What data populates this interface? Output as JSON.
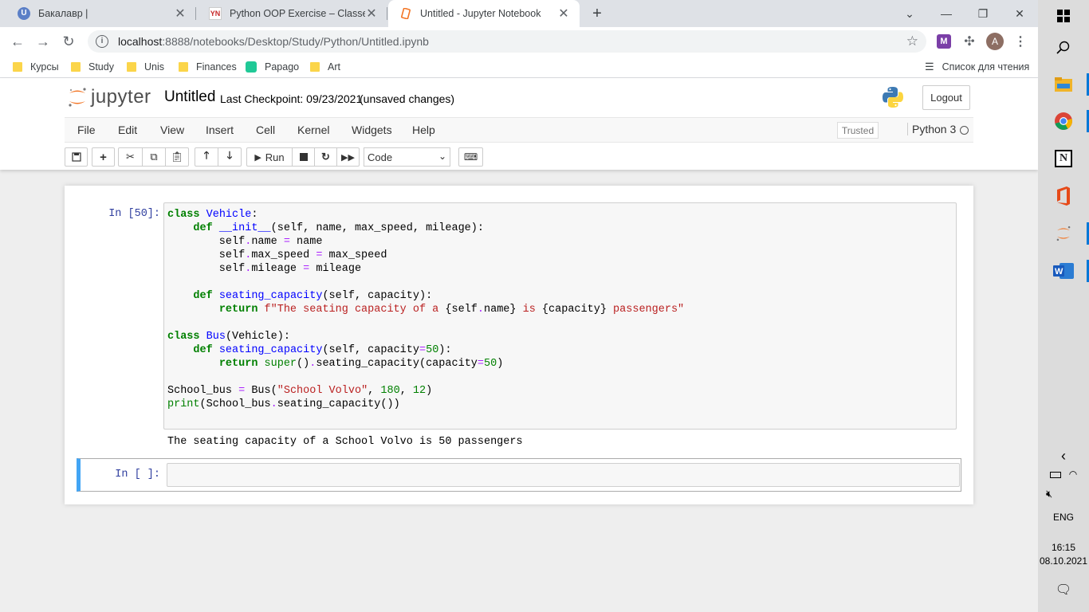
{
  "browser": {
    "tabs": [
      {
        "title": "Бакалавр |",
        "icon": "unis-u-icon",
        "active": false
      },
      {
        "title": "Python OOP Exercise – Classes and",
        "icon": "pynative-icon",
        "active": false
      },
      {
        "title": "Untitled - Jupyter Notebook",
        "icon": "jupyter-tab-icon",
        "active": true
      }
    ],
    "url_host": "localhost",
    "url_rest": ":8888/notebooks/Desktop/Study/Python/Untitled.ipynb",
    "profile_initial": "A",
    "bookmarks": [
      "Курсы",
      "Study",
      "Unis",
      "Finances",
      "Papago",
      "Art"
    ],
    "reading_list": "Список для чтения",
    "colors": {
      "accent": "#42a5f5",
      "tabstrip": "#dee1e6",
      "folder": "#fbd54a"
    }
  },
  "jupyter": {
    "logo_text": "jupyter",
    "notebook_title": "Untitled",
    "checkpoint": "Last Checkpoint: 09/23/2021",
    "unsaved": "(unsaved changes)",
    "logout": "Logout",
    "menu": [
      "File",
      "Edit",
      "View",
      "Insert",
      "Cell",
      "Kernel",
      "Widgets",
      "Help"
    ],
    "trusted": "Trusted",
    "kernel": "Python 3",
    "toolbar": {
      "run": "Run",
      "cell_type": "Code"
    }
  },
  "cells": [
    {
      "prompt": "In [50]:",
      "output": "The seating capacity of a School Volvo is 50 passengers"
    },
    {
      "prompt": "In [ ]:"
    }
  ],
  "taskbar": {
    "language": "ENG",
    "time": "16:15",
    "date": "08.10.2021"
  }
}
